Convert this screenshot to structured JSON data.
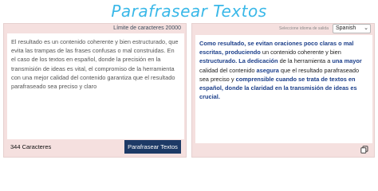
{
  "header": {
    "title": "Parafrasear Textos"
  },
  "input_panel": {
    "limit_label": "Límite de caracteres 20000",
    "text": "El resultado es un contenido coherente y bien estructurado, que evita las trampas de las frases confusas o mal construidas. En el caso de los textos en español, donde la precisión en la transmisión de ideas es vital, el compromiso de la herramienta con una mejor calidad del contenido garantiza que el resultado parafraseado sea preciso y claro",
    "char_count": "344 Caracteres",
    "button_label": "Parafrasear Textos"
  },
  "output_panel": {
    "lang_label": "Seleccione idioma de salida",
    "lang_selected": "Spanish",
    "segments": [
      {
        "t": "Como resultado, se evitan oraciones poco claras o mal escritas, produciendo",
        "b": true
      },
      {
        "t": " un contenido coherente y bien ",
        "b": false
      },
      {
        "t": "estructurado. La dedicación",
        "b": true
      },
      {
        "t": " de la herramienta a ",
        "b": false
      },
      {
        "t": "una mayor",
        "b": true
      },
      {
        "t": " calidad del contenido ",
        "b": false
      },
      {
        "t": "asegura",
        "b": true
      },
      {
        "t": " que el resultado parafraseado sea preciso y ",
        "b": false
      },
      {
        "t": "comprensible cuando se trata de textos en español, donde la claridad en la transmisión de ideas es crucial.",
        "b": true
      }
    ]
  },
  "colors": {
    "title": "#3ab8e8",
    "panel_bg": "#f5e0df",
    "button_bg": "#1d3a66",
    "highlight_text": "#1c3f8a"
  }
}
